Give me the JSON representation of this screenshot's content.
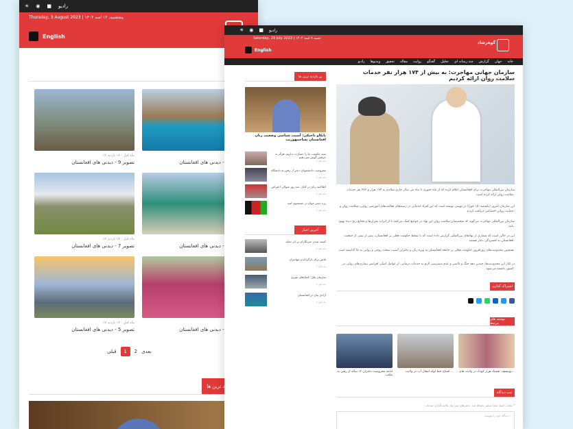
{
  "colors": {
    "accent": "#e03a3a",
    "dark": "#222222"
  },
  "back": {
    "topbar": {
      "radio": "رادیو",
      "icons": [
        "sun-icon",
        "wifi-icon",
        "video-icon"
      ]
    },
    "date": "Thursday, 3 August 2023 | پنجشنبه, ۱۲ اسد ۱۴۰۲",
    "lang": "English",
    "gallery": [
      {
        "caption": "تصویر 9 - دیدنی های افغانستان",
        "meta": "۱۷ ماه قبل · ۱۷ بازدید"
      },
      {
        "caption": "تصویر 8 - دیدنی های افغانستان",
        "meta": "۱۷ ماه قبل"
      },
      {
        "caption": "تصویر 7 - دیدنی های افغانستان",
        "meta": "۱۷ ماه قبل · ۱۷ بازدید"
      },
      {
        "caption": "تصویر 6 - دیدنی های افغانستان",
        "meta": "۱۷ ماه قبل"
      },
      {
        "caption": "تصویر 5 - دیدنی های افغانستان",
        "meta": "۱۷ ماه قبل · ۱۷ بازدید"
      },
      {
        "caption": "تصویر 4 - دیدنی های افغانستان",
        "meta": "۱۷ ماه قبل"
      }
    ],
    "pager": {
      "prev": "قبلی",
      "current": "1",
      "next_page": "2",
      "next": "بعدی"
    },
    "section": "پر بازدید ترین ها"
  },
  "front": {
    "topbar": {
      "radio": "رادیو",
      "icons": [
        "sun-icon",
        "wifi-icon",
        "video-icon"
      ]
    },
    "date": "Saturday, 29 July 2023 | شنبه ۷ اسد ۱۴۰۲",
    "lang": "English",
    "logo_text": "گوهرشاد",
    "nav": [
      "خانه",
      "جهان",
      "گزارش",
      "چند رسانه ای",
      "تحلیل",
      "گفتگو",
      "روایت",
      "مقاله",
      "تحقیق",
      "ویدیوها",
      "رادیو"
    ],
    "article": {
      "title": "سازمان جهانی مهاجرت: به بیش از ۱۷۴ هزار نفر خدمات سلامت روان ارائه کردیم",
      "meta": "۶ ماه قبل · زمان مطالعه: ۱ دقیقه",
      "paragraphs": [
        "سازمان بین‌المللی مهاجرت برای افغانستان اعلام کرده که از ماه جنوری تا ماه می سال جاری میلادی به ۱۷۴ هزار و ۴۷۷ نفر خدمات سلامت روان ارائه کرده است.",
        "این سازمان امروز (یکشنبه، ۱۵ جوزا) در توییتی نوشته است که این افراد خدماتی در زمینه‌های فعالیت‌های آموزشی روانی، سلامت روان و حمایت روانی-اجتماعی دریافت کردند.",
        "سازمان بین‌المللی مهاجرت می‌گوید که متخصصان سلامت روان این نهاد در جوامع کمک می‌کنند تا از اثرات بحران‌ها و فجایع رنج دیده بهبود یابند.",
        "این در حالی است که شماری از نهادهای بین‌المللی گزارش داده است که با تسلط حکومت فعلی بر افغانستان، بیش از نیمی از جمعیت افغانستان به افسردگی دچار هستند.",
        "همچنین محدودیت‌های روزافزون حکومت فعلی بر جامعه افغانستان به ویژه زنان و دختران آسیب سخت روحی و روانی به جا گذاشته است.",
        "در کنار این محدودیت‌ها، چندین دهه جنگ و ناامنی و عدم دسترسی لازم به خدمات درمانی، از عوامل اصلی افزایش بیماری‌های روانی در کشور دانسته می‌شود."
      ],
      "share": "اشتراک گذاری",
      "related": "نوشته های مرتبط",
      "related_items": [
        "یونیسف: هشتاد هزار کودک در ولایت های...",
        "افتتاح خط لوله انتقال آب در ولایت ...",
        "ادامه محرومیت دختران ۱۲ ساله از رفتن به مکتب"
      ],
      "comment": "ثبت دیدگاه",
      "comment_note": "نشانی ایمیل شما منتشر نخواهد شد. بخش‌های موردنیاز علامت‌گذاری شده‌اند *",
      "comment_placeholder": "دیدگاه خود را بنویسید..."
    },
    "sidebar": {
      "popular_head": "پر بازدید ترین ها",
      "feature_caption": "بانکاو تاجیکی: آسیب شناسی وضعیت زنان افغانستان پساجمهوریت",
      "popular": [
        {
          "title": "سند حکومت ما را خسارت نداریم، هرگز به حرفش گوش نمی‌دهیم",
          "date": "۸ ماه قبل"
        },
        {
          "title": "محرومیت دانشجویان دختر از رفتن به دانشگاه",
          "date": "۸ ماه قبل"
        },
        {
          "title": "اطلاعیه زنان در کابل: سه روز متوالی اعتراض",
          "date": "۸ ماه قبل"
        },
        {
          "title": "رژه دختر جوان در جستجوی امید",
          "date": "۸ ماه قبل"
        }
      ],
      "latest_head": "آخرین اخبار",
      "latest": [
        {
          "title": "کشته شدن خبرنگاران بر اثر حمله",
          "date": "۶ ماه قبل"
        },
        {
          "title": "تلاش برای بازگرداندن مهاجران",
          "date": "۶ ماه قبل"
        },
        {
          "title": "سازمان ملل: کمک‌های بشری",
          "date": "۶ ماه قبل"
        },
        {
          "title": "آزادی بیان در افغانستان",
          "date": "۶ ماه قبل"
        }
      ]
    }
  }
}
